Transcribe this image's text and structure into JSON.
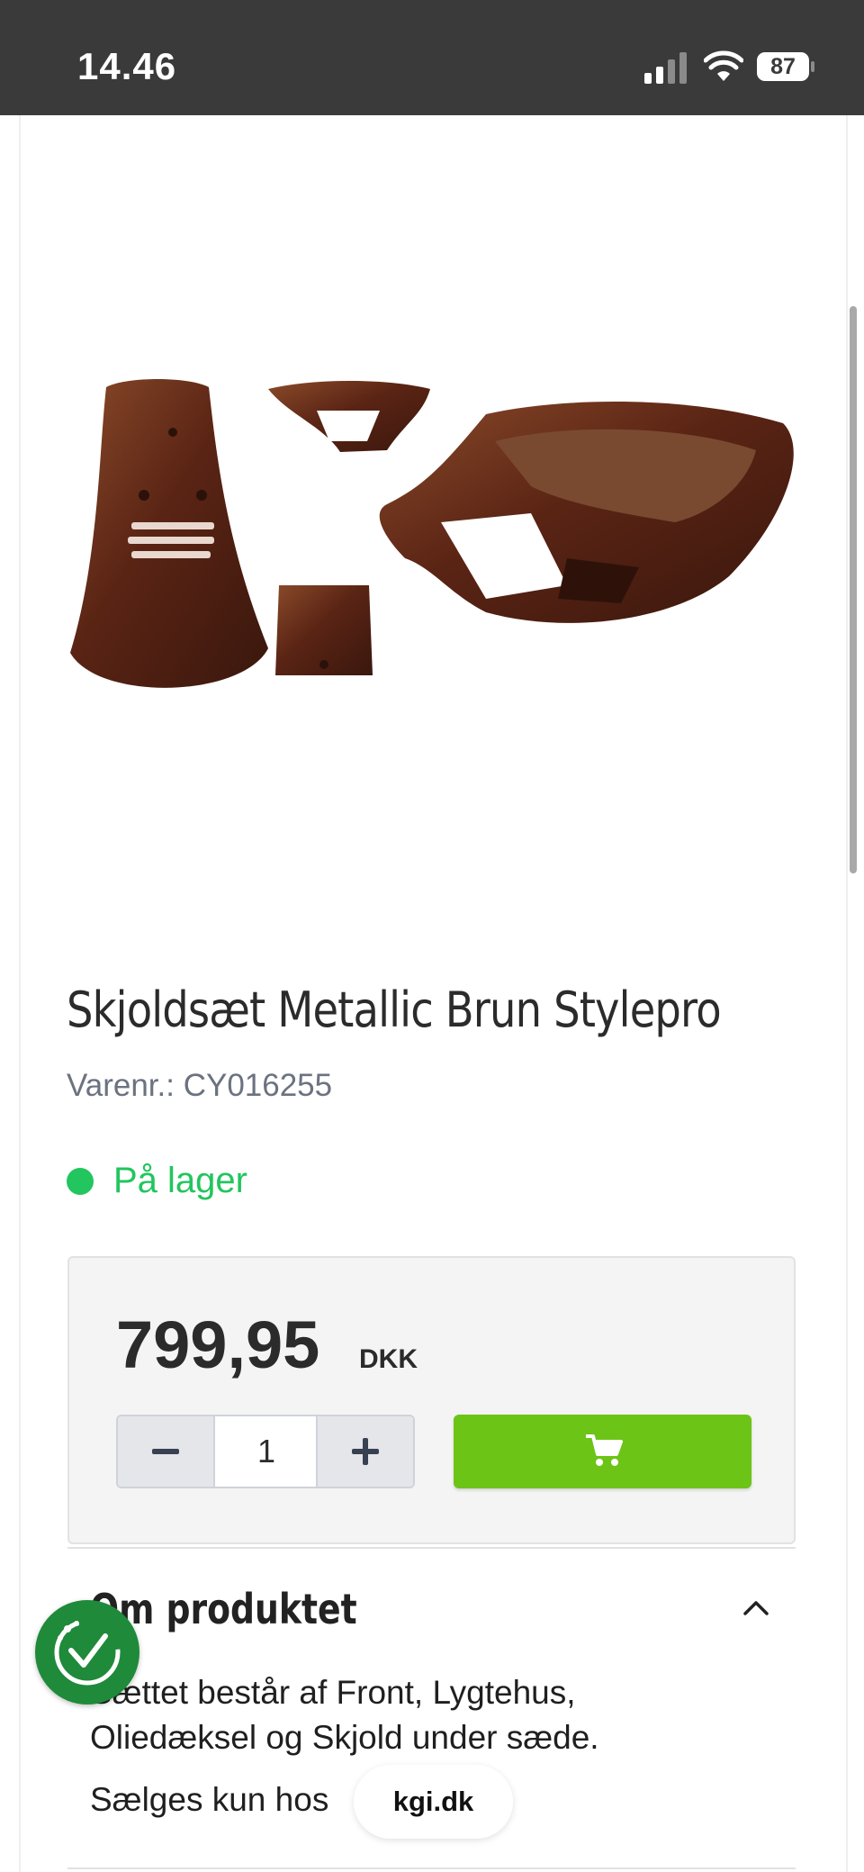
{
  "status_bar": {
    "time": "14.46",
    "battery": "87"
  },
  "product": {
    "title": "Skjoldsæt Metallic Brun Stylepro",
    "sku": "Varenr.: CY016255",
    "stock": "På lager",
    "price": "799,95",
    "currency": "DKK",
    "quantity": "1"
  },
  "accordion": {
    "title": "Om produktet",
    "description": "Sættet består af Front, Lygtehus, Oliedæksel og Skjold under sæde.",
    "note": "Sælges kun hos"
  },
  "browser": {
    "url": "kgi.dk"
  },
  "colors": {
    "accent_green": "#6cc417",
    "stock_green": "#22c55e",
    "status_bar": "#3a3a3a"
  },
  "icons": [
    "signal-icon",
    "wifi-icon",
    "battery-icon",
    "minus-icon",
    "plus-icon",
    "cart-icon",
    "chevron-up-icon",
    "trust-badge-icon"
  ]
}
